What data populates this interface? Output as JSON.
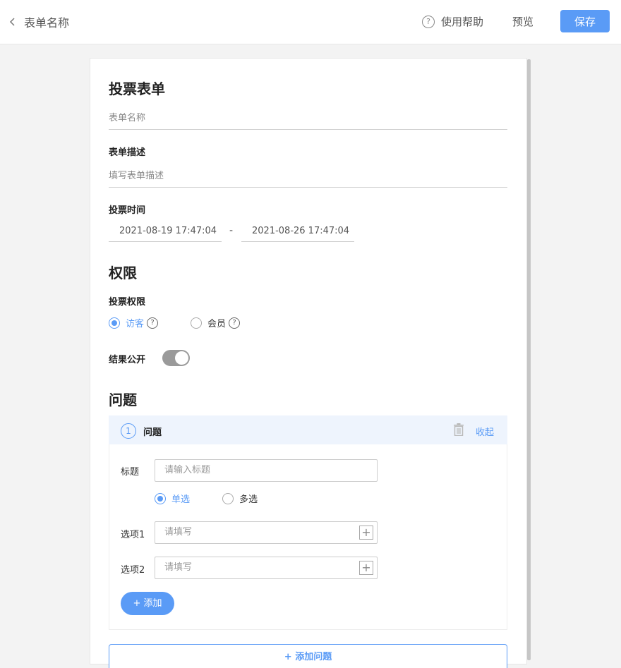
{
  "header": {
    "back_title": "表单名称",
    "help_label": "使用帮助",
    "help_icon_glyph": "?",
    "preview_label": "预览",
    "save_label": "保存"
  },
  "form": {
    "title": "投票表单",
    "name_placeholder": "表单名称",
    "desc_label": "表单描述",
    "desc_placeholder": "填写表单描述",
    "time_label": "投票时间",
    "start_time": "2021-08-19 17:47:04",
    "time_separator": "-",
    "end_time": "2021-08-26 17:47:04"
  },
  "permissions": {
    "section_title": "权限",
    "vote_label": "投票权限",
    "options": [
      {
        "label": "访客",
        "selected": true
      },
      {
        "label": "会员",
        "selected": false
      }
    ],
    "help_glyph": "?",
    "public_label": "结果公开",
    "public_on": true
  },
  "questions": {
    "section_title": "问题",
    "items": [
      {
        "number": "1",
        "heading": "问题",
        "collapse_label": "收起",
        "title_label": "标题",
        "title_placeholder": "请输入标题",
        "types": [
          {
            "label": "单选",
            "selected": true
          },
          {
            "label": "多选",
            "selected": false
          }
        ],
        "options": [
          {
            "label": "选项1",
            "placeholder": "请填写"
          },
          {
            "label": "选项2",
            "placeholder": "请填写"
          }
        ],
        "add_option_label": "+ 添加"
      }
    ],
    "add_question_label": "+ 添加问题"
  },
  "colors": {
    "accent": "#5a9bf6",
    "toggle": "#9a9a9a",
    "question_header_bg": "#eef4fd"
  },
  "icons": {
    "back": "chevron-left-icon",
    "help": "question-circle-icon",
    "delete": "trash-icon",
    "option_add": "plus-square-icon"
  }
}
